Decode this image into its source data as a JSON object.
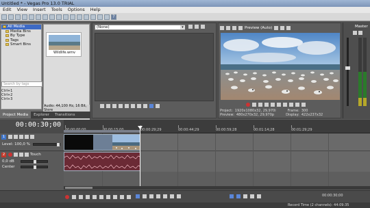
{
  "window": {
    "title": "Untitled * - Vegas Pro 13.0 TRIAL"
  },
  "menu": [
    "Edit",
    "View",
    "Insert",
    "Tools",
    "Options",
    "Help"
  ],
  "explorer": {
    "tree": [
      {
        "label": "All Media",
        "selected": true
      },
      {
        "label": "Media Bins",
        "selected": false
      },
      {
        "label": "By Type",
        "selected": false
      },
      {
        "label": "Tags",
        "selected": false
      },
      {
        "label": "Smart Bins",
        "selected": false
      }
    ],
    "media_file": "Wildlife.wmv",
    "search_placeholder": "Search by tags",
    "shortcuts": [
      "Ctrl+1",
      "Ctrl+2",
      "Ctrl+3"
    ],
    "media_info": [
      "Audio: 44,100 Hz, 16 Bit, Stere",
      "Video: 1280x720x24, 29,970 fr"
    ],
    "tabs": [
      "Project Media",
      "Explorer",
      "Transitions"
    ]
  },
  "trimmer": {
    "selector_value": "(None)"
  },
  "preview": {
    "mode_label": "Preview (Auto)",
    "info": {
      "project_label": "Project:",
      "project_value": "1920x1080x32, 29,970i",
      "preview_label": "Preview:",
      "preview_value": "480x270x32, 29,970p",
      "frame_label": "Frame:",
      "frame_value": "300",
      "display_label": "Display:",
      "display_value": "422x237x32"
    }
  },
  "master": {
    "label": "Master"
  },
  "timeline": {
    "timecode": "00:00:30;00",
    "ruler_labels": [
      "00:00:00;00",
      "00:00:15;00",
      "00:00:29;29",
      "00:00:44;29",
      "00:00:59;28",
      "00:01:14;28",
      "00:01:29;29"
    ],
    "video_track": {
      "number": "1",
      "level_label": "Level: 100,0 %"
    },
    "audio_track": {
      "number": "2",
      "vol_label": "0,0 dB",
      "pan_label": "Center",
      "touch_label": "Touch"
    }
  },
  "bottom": {
    "timecode": "00:00:30;00"
  },
  "status": {
    "record_time": "Record Time (2 channels): 44:09:35"
  }
}
